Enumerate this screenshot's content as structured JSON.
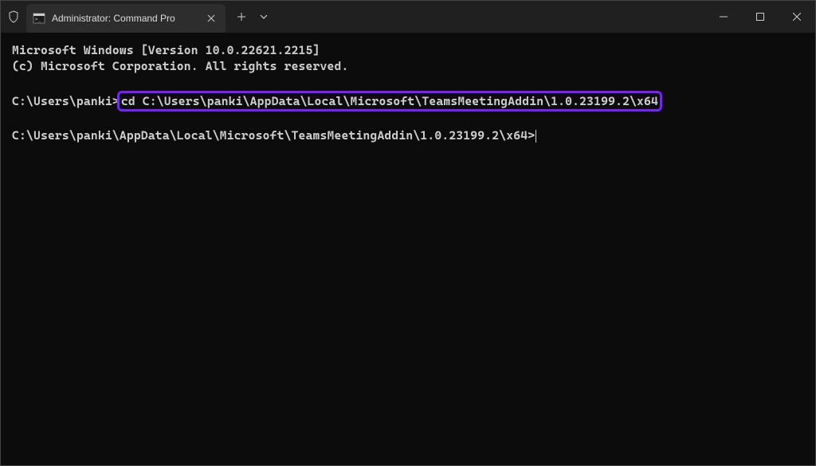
{
  "tab": {
    "title": "Administrator: Command Pro"
  },
  "terminal": {
    "line1": "Microsoft Windows [Version 10.0.22621.2215]",
    "line2": "(c) Microsoft Corporation. All rights reserved.",
    "prompt1_prefix": "C:\\Users\\panki>",
    "highlighted_command": "cd C:\\Users\\panki\\AppData\\Local\\Microsoft\\TeamsMeetingAddin\\1.0.23199.2\\x64",
    "prompt2": "C:\\Users\\panki\\AppData\\Local\\Microsoft\\TeamsMeetingAddin\\1.0.23199.2\\x64>"
  }
}
